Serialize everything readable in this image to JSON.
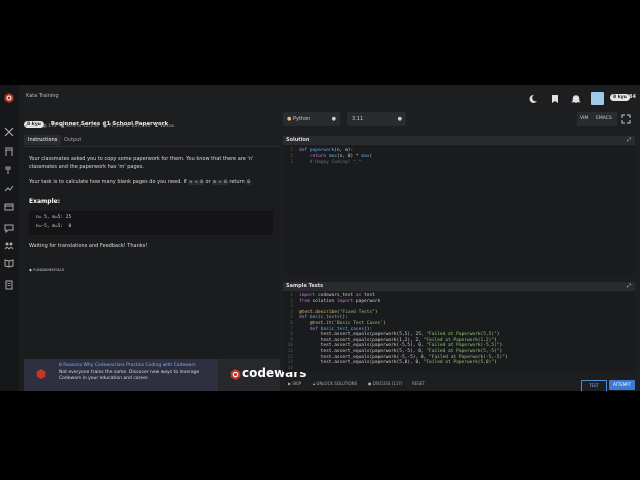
{
  "header": {
    "breadcrumb": "Kata Training",
    "rank": "8 kyu",
    "honor": "84"
  },
  "kata": {
    "kyu": "8 kyu",
    "title": "Beginner Series #1 School Paperwork",
    "stats": {
      "favorites": "749",
      "collections": "173",
      "satisfaction": "90% of 12,254",
      "completed": "77,349 of 257,133",
      "author": "Vortas"
    }
  },
  "tabs": [
    {
      "label": "Instructions"
    },
    {
      "label": "Output"
    }
  ],
  "description": {
    "p1": "Your classmates asked you to copy some paperwork for them. You know that there are 'n' classmates and the paperwork has 'm' pages.",
    "p2_pre": "Your task is to calculate how many blank pages do you need. If",
    "p2_code1": "n < 0",
    "p2_or": "or",
    "p2_code2": "m < 0",
    "p2_return": "return",
    "p2_code3": "0",
    "example_heading": "Example:",
    "example_lines": [
      "n= 5, m=5: 25",
      "n=-5, m=5:  0"
    ],
    "footer": "Waiting for translations and Feedback! Thanks!",
    "tag": "FUNDAMENTALS"
  },
  "ad": {
    "headline": "8 Reasons Why Codewarriors Practice Coding with Codewars",
    "body": "Not everyone trains the same. Discover new ways to leverage Codewars in your education and career.",
    "brand": "codewars"
  },
  "editor_controls": {
    "language": "Python",
    "version": "3.11",
    "vim": "VIM",
    "emacs": "EMACS"
  },
  "solution": {
    "title": "Solution",
    "lines": [
      [
        {
          "t": "def ",
          "c": "k"
        },
        {
          "t": "paperwork",
          "c": "f"
        },
        {
          "t": "(n, m):",
          "c": "t"
        }
      ],
      [
        {
          "t": "    return ",
          "c": "k"
        },
        {
          "t": "max",
          "c": "f"
        },
        {
          "t": "(n, 0) * ",
          "c": "t"
        },
        {
          "t": "max",
          "c": "f"
        },
        {
          "t": "(",
          "c": "t"
        }
      ],
      [
        {
          "t": "    # Happy Coding! ^_^",
          "c": "c"
        }
      ]
    ]
  },
  "tests": {
    "title": "Sample Tests",
    "lines": [
      [
        {
          "t": "import ",
          "c": "k"
        },
        {
          "t": "codewars_test ",
          "c": "t"
        },
        {
          "t": "as ",
          "c": "k"
        },
        {
          "t": "test",
          "c": "t"
        }
      ],
      [
        {
          "t": "from ",
          "c": "k"
        },
        {
          "t": "solution ",
          "c": "t"
        },
        {
          "t": "import ",
          "c": "k"
        },
        {
          "t": "paperwork",
          "c": "t"
        }
      ],
      [
        {
          "t": "",
          "c": "t"
        }
      ],
      [
        {
          "t": "@test.describe(",
          "c": "d"
        },
        {
          "t": "\"Fixed Tests\"",
          "c": "s"
        },
        {
          "t": ")",
          "c": "d"
        }
      ],
      [
        {
          "t": "def ",
          "c": "k"
        },
        {
          "t": "basic_tests",
          "c": "f"
        },
        {
          "t": "():",
          "c": "t"
        }
      ],
      [
        {
          "t": "    @test.it(",
          "c": "d"
        },
        {
          "t": "'Basic Test Cases'",
          "c": "s"
        },
        {
          "t": ")",
          "c": "d"
        }
      ],
      [
        {
          "t": "    def ",
          "c": "k"
        },
        {
          "t": "basic_test_cases",
          "c": "f"
        },
        {
          "t": "():",
          "c": "t"
        }
      ],
      [
        {
          "t": "        test.assert_equals(paperwork(5,5), 25, ",
          "c": "t"
        },
        {
          "t": "\"Failed at Paperwork(5,5)\"",
          "c": "s"
        },
        {
          "t": ")",
          "c": "t"
        }
      ],
      [
        {
          "t": "        test.assert_equals(paperwork(1,2), 2, ",
          "c": "t"
        },
        {
          "t": "\"Failed at Paperwork(1,2)\"",
          "c": "s"
        },
        {
          "t": ")",
          "c": "t"
        }
      ],
      [
        {
          "t": "        test.assert_equals(paperwork(-5,5), 0, ",
          "c": "t"
        },
        {
          "t": "\"Failed at Paperwork(-5,5)\"",
          "c": "s"
        },
        {
          "t": ")",
          "c": "t"
        }
      ],
      [
        {
          "t": "        test.assert_equals(paperwork(5,-5), 0, ",
          "c": "t"
        },
        {
          "t": "\"Failed at Paperwork(5,-5)\"",
          "c": "s"
        },
        {
          "t": ")",
          "c": "t"
        }
      ],
      [
        {
          "t": "        test.assert_equals(paperwork(-5,-5), 0, ",
          "c": "t"
        },
        {
          "t": "\"Failed at Paperwork(-5,-5)\"",
          "c": "s"
        },
        {
          "t": ")",
          "c": "t"
        }
      ],
      [
        {
          "t": "        test.assert_equals(paperwork(5,0), 0, ",
          "c": "t"
        },
        {
          "t": "\"Failed at Paperwork(5,0)\"",
          "c": "s"
        },
        {
          "t": ")",
          "c": "t"
        }
      ],
      [
        {
          "t": "",
          "c": "t"
        }
      ]
    ]
  },
  "bottom": {
    "skip": "SKIP",
    "unlock": "UNLOCK SOLUTIONS",
    "discuss": "DISCUSS (117)",
    "reset": "RESET",
    "test": "TEST",
    "attempt": "ATTEMPT"
  },
  "colors": {
    "accent": "#b1361e",
    "attempt": "#3b7bd6",
    "test_border": "#4a8fd8",
    "ad_icon": "#c8352b"
  }
}
